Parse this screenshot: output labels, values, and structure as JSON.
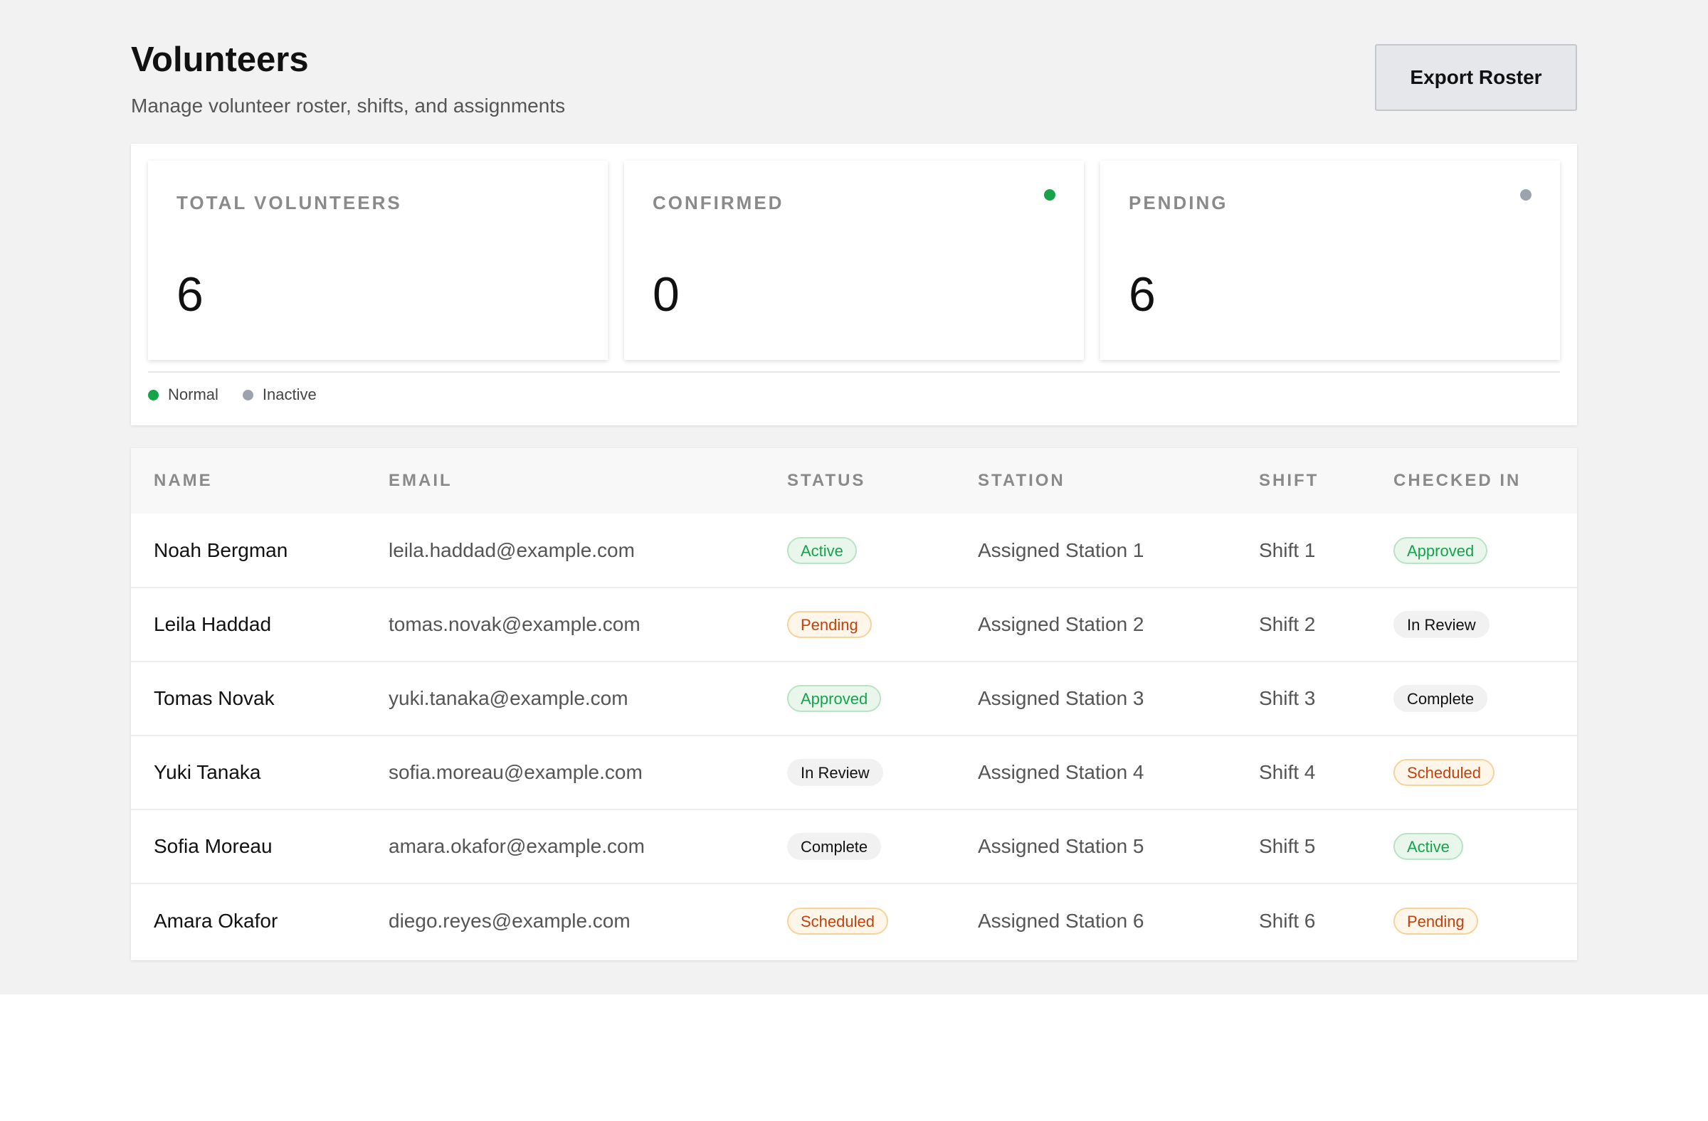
{
  "header": {
    "title": "Volunteers",
    "subtitle": "Manage volunteer roster, shifts, and assignments",
    "export_label": "Export Roster"
  },
  "stats": [
    {
      "label": "TOTAL VOLUNTEERS",
      "value": "6",
      "indicator": null
    },
    {
      "label": "CONFIRMED",
      "value": "0",
      "indicator": "#16a34a"
    },
    {
      "label": "PENDING",
      "value": "6",
      "indicator": "#9ca3af"
    }
  ],
  "legend": [
    {
      "label": "Normal",
      "color": "#16a34a"
    },
    {
      "label": "Inactive",
      "color": "#9ca3af"
    }
  ],
  "table": {
    "columns": [
      "NAME",
      "EMAIL",
      "STATUS",
      "STATION",
      "SHIFT",
      "CHECKED IN"
    ],
    "rows": [
      {
        "name": "Noah Bergman",
        "email": "leila.haddad@example.com",
        "status": "Active",
        "station": "Assigned Station 1",
        "shift": "Shift 1",
        "checked_in": "Approved"
      },
      {
        "name": "Leila Haddad",
        "email": "tomas.novak@example.com",
        "status": "Pending",
        "station": "Assigned Station 2",
        "shift": "Shift 2",
        "checked_in": "In Review"
      },
      {
        "name": "Tomas Novak",
        "email": "yuki.tanaka@example.com",
        "status": "Approved",
        "station": "Assigned Station 3",
        "shift": "Shift 3",
        "checked_in": "Complete"
      },
      {
        "name": "Yuki Tanaka",
        "email": "sofia.moreau@example.com",
        "status": "In Review",
        "station": "Assigned Station 4",
        "shift": "Shift 4",
        "checked_in": "Scheduled"
      },
      {
        "name": "Sofia Moreau",
        "email": "amara.okafor@example.com",
        "status": "Complete",
        "station": "Assigned Station 5",
        "shift": "Shift 5",
        "checked_in": "Active"
      },
      {
        "name": "Amara Okafor",
        "email": "diego.reyes@example.com",
        "status": "Scheduled",
        "station": "Assigned Station 6",
        "shift": "Shift 6",
        "checked_in": "Pending"
      }
    ]
  },
  "badge_styles": {
    "Active": "green",
    "Approved": "green",
    "Pending": "orange",
    "Scheduled": "orange",
    "In Review": "neutral",
    "Complete": "neutral"
  },
  "colors": {
    "page_background": "#f2f2f2",
    "green": "#16a34a",
    "orange": "#c2410c",
    "gray": "#9ca3af"
  }
}
